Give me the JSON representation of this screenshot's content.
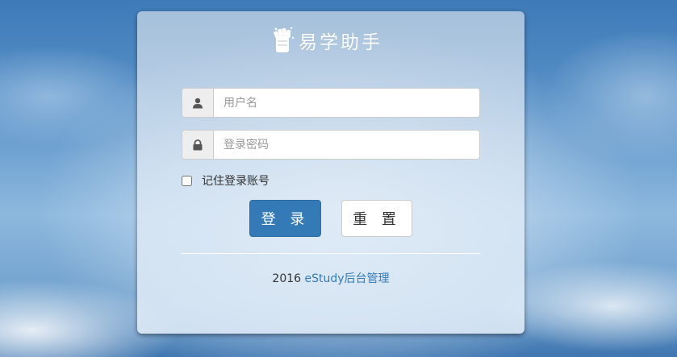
{
  "brand": {
    "logo_icon": "raised-fist-icon",
    "title": "易学助手"
  },
  "form": {
    "username": {
      "icon": "user-icon",
      "placeholder": "用户名",
      "value": ""
    },
    "password": {
      "icon": "lock-icon",
      "placeholder": "登录密码",
      "value": ""
    },
    "remember": {
      "label": "记住登录账号",
      "checked": false
    },
    "login_label": "登 录",
    "reset_label": "重 置"
  },
  "footer": {
    "year": "2016",
    "link_text": "eStudy后台管理"
  },
  "colors": {
    "primary": "#337ab7",
    "addon_bg": "#eeeeee",
    "border": "#cccccc"
  }
}
